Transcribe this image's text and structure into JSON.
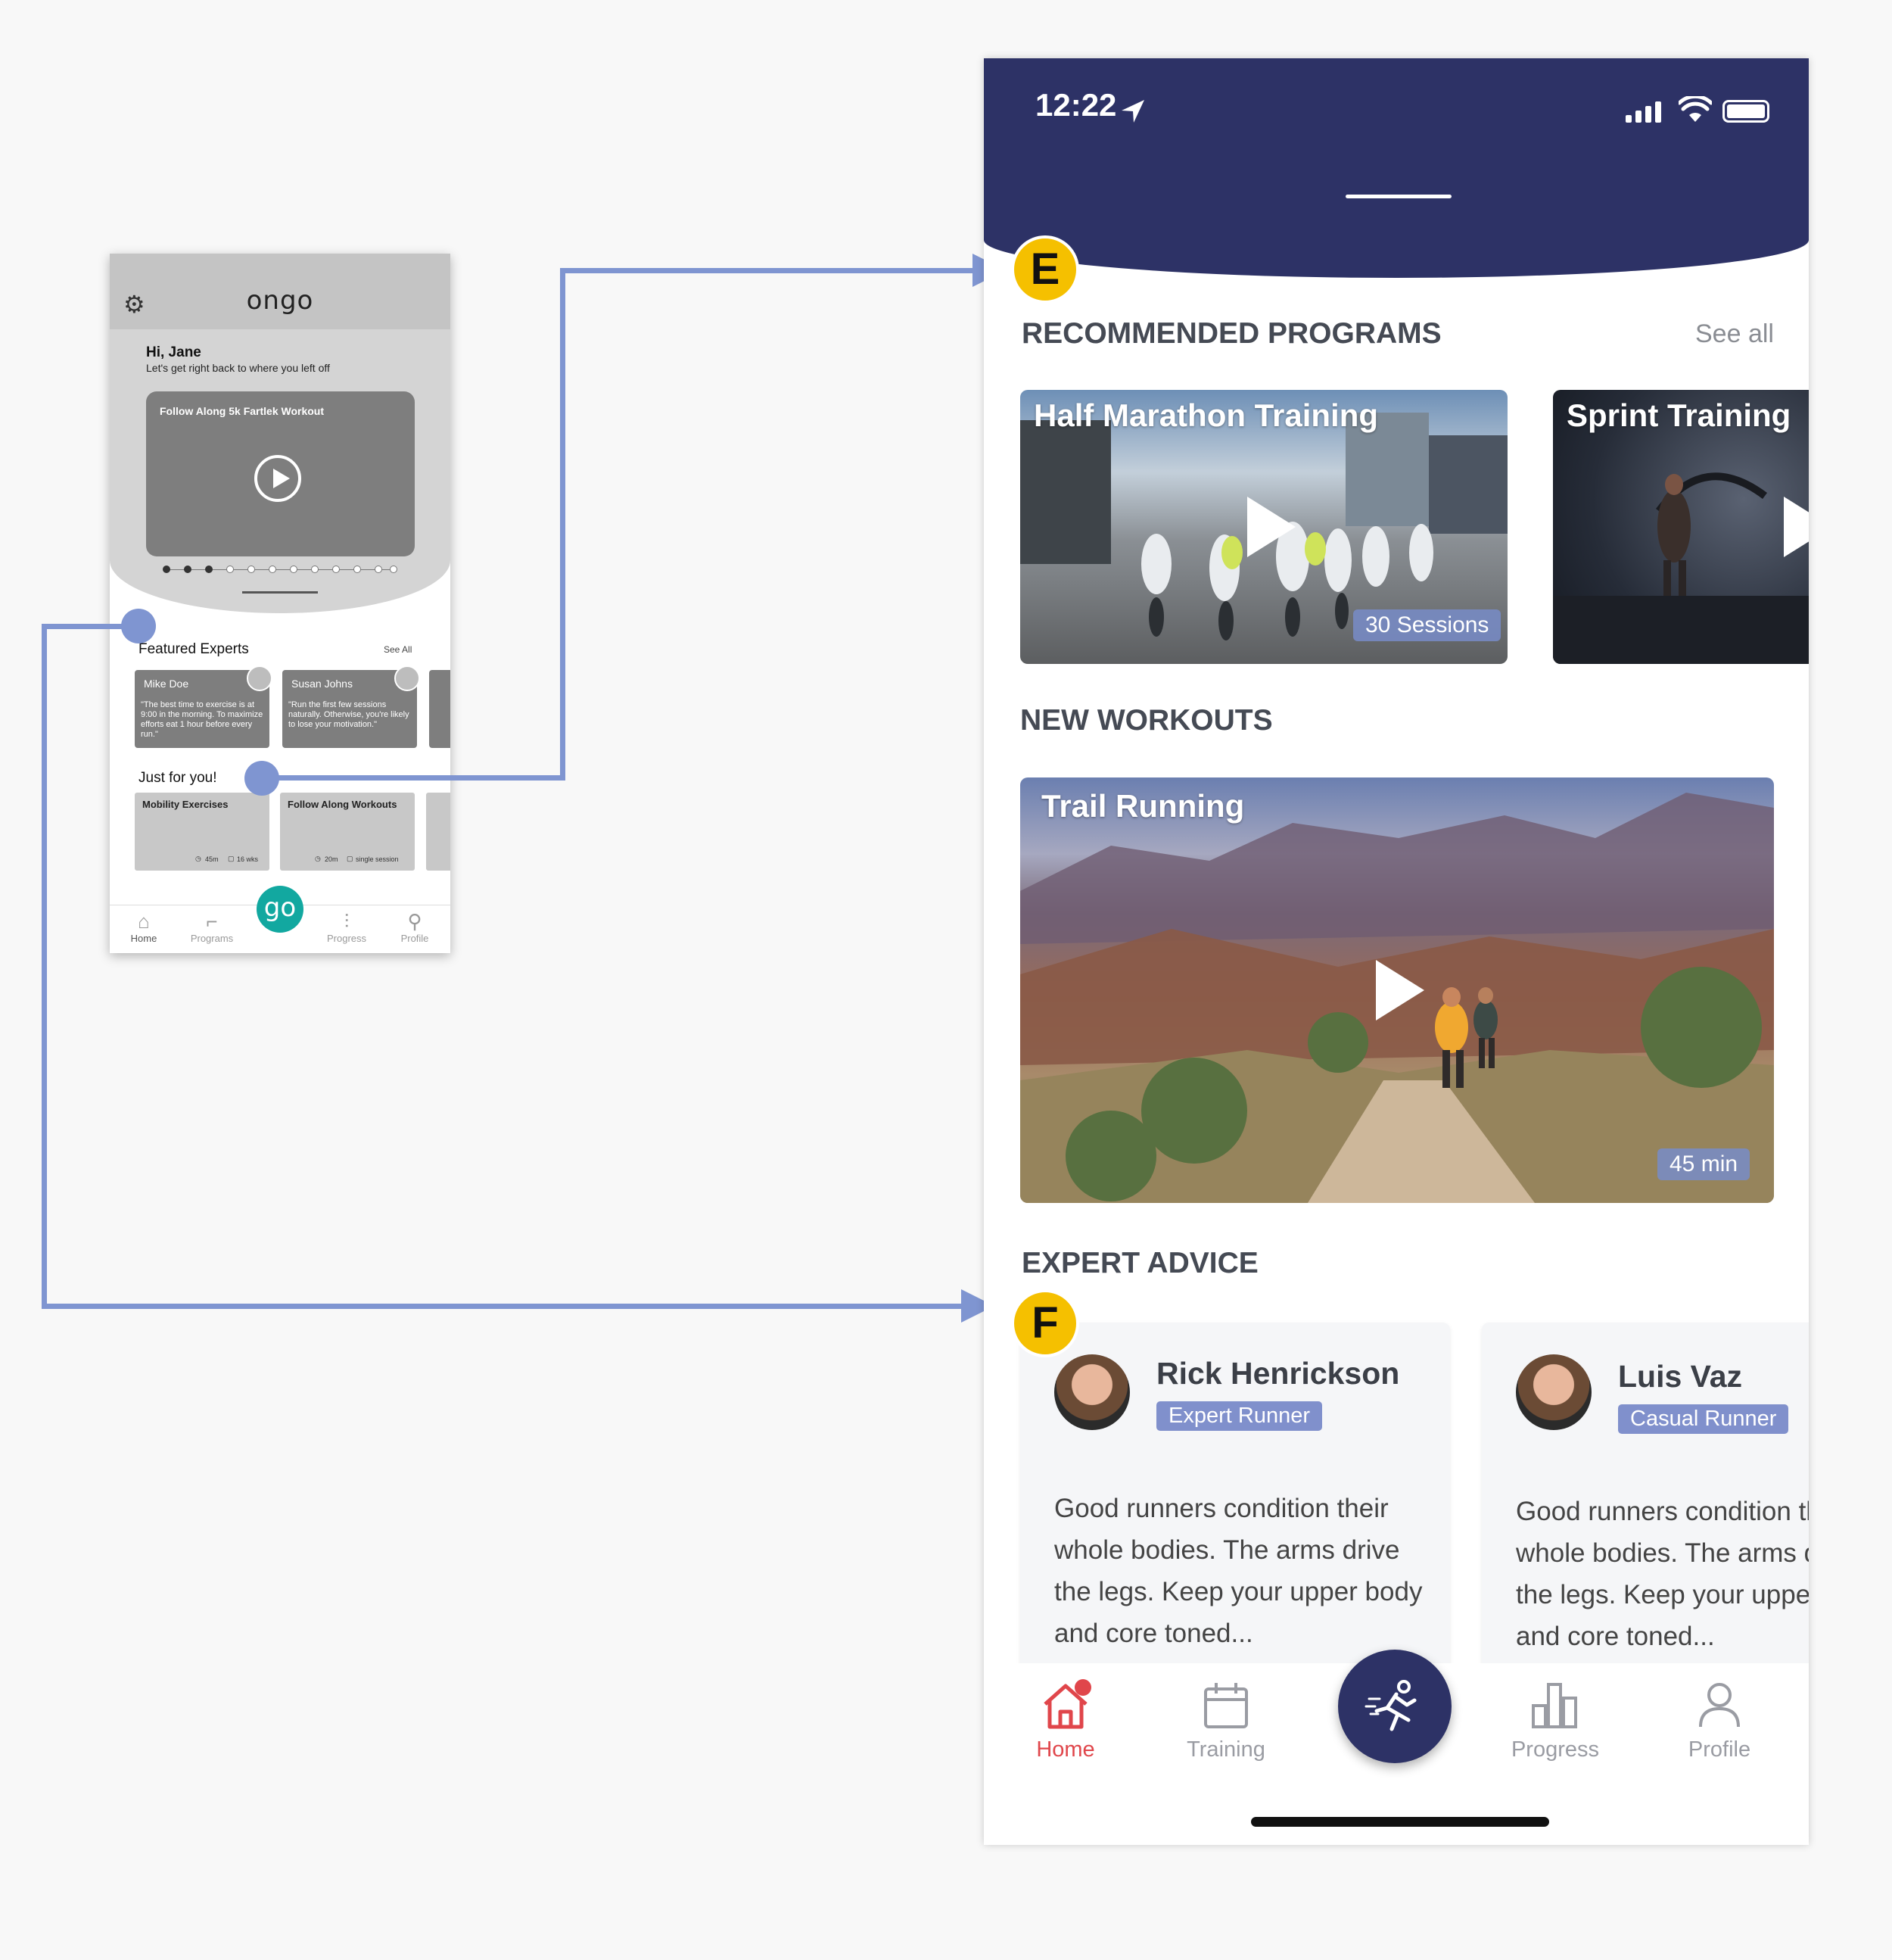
{
  "wireframe": {
    "logo": "ongo",
    "greeting": "Hi, Jane",
    "subtitle": "Let's get right back to where you left off",
    "hero_title": "Follow Along 5k Fartlek Workout",
    "featured_title": "Featured Experts",
    "featured_see_all": "See All",
    "experts": [
      {
        "name": "Mike Doe",
        "quote": "\"The best time to exercise is at 9:00 in the morning. To maximize efforts eat 1 hour before every run.\""
      },
      {
        "name": "Susan Johns",
        "quote": "\"Run the first few sessions naturally. Otherwise, you're likely to lose your motivation.\""
      }
    ],
    "just_for_you_title": "Just for you!",
    "workouts": [
      {
        "title": "Mobility Exercises",
        "duration": "45m",
        "length": "16 wks"
      },
      {
        "title": "Follow Along Workouts",
        "duration": "20m",
        "length": "single session"
      }
    ],
    "tabs": [
      "Home",
      "Programs",
      "Progress",
      "Profile"
    ],
    "go_label": "go"
  },
  "annotations": {
    "e": "E",
    "f": "F"
  },
  "phone": {
    "status_time": "12:22",
    "recommended_title": "RECOMMENDED PROGRAMS",
    "see_all": "See all",
    "programs": [
      {
        "title": "Half Marathon Training",
        "badge": "30 Sessions"
      },
      {
        "title": "Sprint Training"
      }
    ],
    "new_workouts_title": "NEW WORKOUTS",
    "workout": {
      "title": "Trail Running",
      "badge": "45 min"
    },
    "expert_advice_title": "EXPERT ADVICE",
    "experts": [
      {
        "name": "Rick Henrickson",
        "tag": "Expert Runner",
        "text": "Good runners condition their whole bodies. The arms drive the legs. Keep your upper body and core toned..."
      },
      {
        "name": "Luis Vaz",
        "tag": "Casual Runner",
        "text": "Good runners condition their whole bodies. The arms drive the legs. Keep your upper body and core toned..."
      }
    ],
    "nav": [
      "Home",
      "Training",
      "Progress",
      "Profile"
    ]
  },
  "colors": {
    "header_navy": "#2d3266",
    "connector": "#7f95d1",
    "badge_yellow": "#f5c000",
    "active_red": "#e0464b",
    "wire_teal": "#12a8a0"
  }
}
